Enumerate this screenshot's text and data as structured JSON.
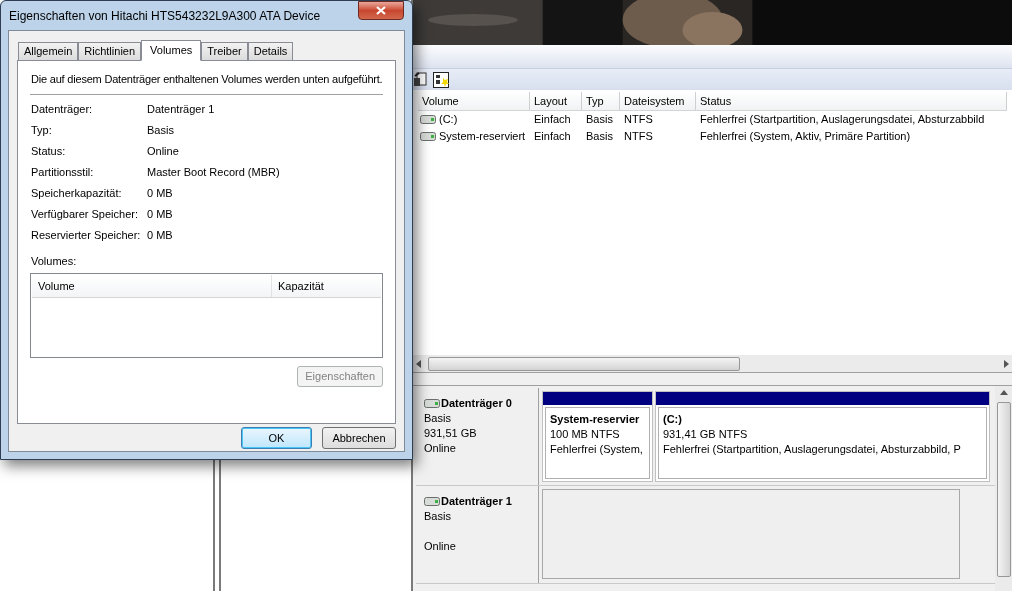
{
  "dialog": {
    "title": "Eigenschaften von Hitachi HTS543232L9A300 ATA Device",
    "tabs": [
      {
        "label": "Allgemein",
        "selected": false
      },
      {
        "label": "Richtlinien",
        "selected": false
      },
      {
        "label": "Volumes",
        "selected": true
      },
      {
        "label": "Treiber",
        "selected": false
      },
      {
        "label": "Details",
        "selected": false
      }
    ],
    "intro": "Die auf diesem Datenträger enthaltenen Volumes werden unten aufgeführt.",
    "properties": [
      {
        "label": "Datenträger:",
        "value": "Datenträger 1"
      },
      {
        "label": "Typ:",
        "value": "Basis"
      },
      {
        "label": "Status:",
        "value": "Online"
      },
      {
        "label": "Partitionsstil:",
        "value": "Master Boot Record (MBR)"
      },
      {
        "label": "Speicherkapazität:",
        "value": "0 MB"
      },
      {
        "label": "Verfügbarer Speicher:",
        "value": "0 MB"
      },
      {
        "label": "Reservierter Speicher:",
        "value": "0 MB"
      }
    ],
    "volumes_label": "Volumes:",
    "volumes_table": {
      "columns": [
        "Volume",
        "Kapazität"
      ]
    },
    "properties_button": {
      "label": "Eigenschaften",
      "disabled": true
    },
    "buttons": [
      {
        "label": "OK",
        "default": true
      },
      {
        "label": "Abbrechen",
        "default": false
      }
    ]
  },
  "disk_management": {
    "volume_list": {
      "columns": [
        "Volume",
        "Layout",
        "Typ",
        "Dateisystem",
        "Status"
      ],
      "rows": [
        [
          "(C:)",
          "Einfach",
          "Basis",
          "NTFS",
          "Fehlerfrei (Startpartition, Auslagerungsdatei, Absturzabbild"
        ],
        [
          "System-reserviert",
          "Einfach",
          "Basis",
          "NTFS",
          "Fehlerfrei (System, Aktiv, Primäre Partition)"
        ]
      ]
    },
    "disks": [
      {
        "name": "Datenträger 0",
        "type": "Basis",
        "size": "931,51 GB",
        "status": "Online",
        "partitions": [
          {
            "name": "System-reservier",
            "size": "100 MB NTFS",
            "status": "Fehlerfrei (System,"
          },
          {
            "name": "(C:)",
            "size": "931,41 GB NTFS",
            "status": "Fehlerfrei (Startpartition, Auslagerungsdatei, Absturzabbild, P"
          }
        ]
      },
      {
        "name": "Datenträger 1",
        "type": "Basis",
        "status": "Online"
      }
    ]
  }
}
